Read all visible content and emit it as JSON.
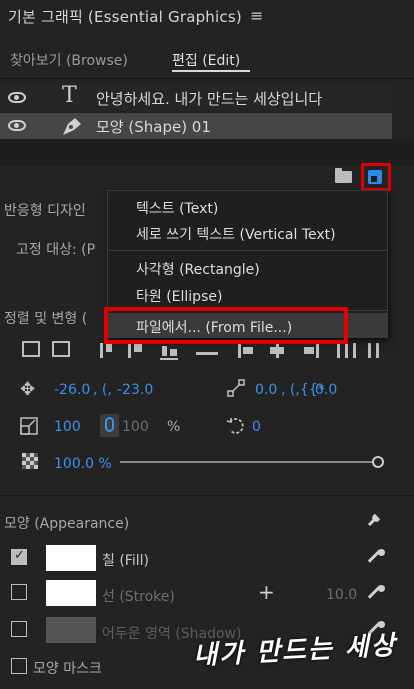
{
  "panel": {
    "title": "기본 그래픽 (Essential Graphics)",
    "menu_icon": "hamburger-icon"
  },
  "tabs": [
    {
      "label": "찾아보기 (Browse)",
      "active": false
    },
    {
      "label": "편집 (Edit)",
      "active": true
    }
  ],
  "layers": [
    {
      "type_icon": "text-T-icon",
      "name": "안녕하세요. 내가 만드는 세상입니다",
      "selected": false
    },
    {
      "type_icon": "pen-icon",
      "name": "모양 (Shape) 01",
      "selected": true
    }
  ],
  "toolbar": {
    "folder_icon": "folder-icon",
    "new_layer_icon": "new-layer-icon"
  },
  "new_layer_menu": {
    "items": [
      {
        "label": "텍스트 (Text)"
      },
      {
        "label": "세로 쓰기 텍스트 (Vertical Text)"
      },
      {
        "label": "사각형 (Rectangle)"
      },
      {
        "label": "타원 (Ellipse)"
      },
      {
        "label": "파일에서... (From File...)",
        "hovered": true
      }
    ]
  },
  "responsive": {
    "label": "반응형 디자인",
    "pin_label": "고정 대상: (P"
  },
  "align_transform": {
    "label": "정렬 및 변형 ("
  },
  "transform": {
    "position_x": "-26.0",
    "position_y_sep": ", (,",
    "position_y": "-23.0",
    "anchor_value": "0.0",
    "anchor_sep": ", (,{{*",
    "anchor_y": "0.0",
    "scale": "100",
    "scale_locked": "100",
    "scale_unit": "%",
    "rotation": "0",
    "opacity": "100.0 %",
    "opacity_level": 1.0
  },
  "appearance": {
    "label": "모양 (Appearance)",
    "wrench_icon": "wrench-icon",
    "fill": {
      "label": "칠 (Fill)",
      "checked": true,
      "color": "#ffffff"
    },
    "stroke": {
      "label": "선 (Stroke)",
      "checked": false,
      "color": "#ffffff",
      "value": "10.0"
    },
    "shadow": {
      "label": "어두운 영역 (Shadow)",
      "checked": false,
      "color": "#555555"
    },
    "mask": {
      "label": "모양 마스크",
      "checked": false
    }
  },
  "watermark": "내가 만드는 세상",
  "colors": {
    "accent_blue": "#3e90e8",
    "highlight_red": "#e00000",
    "panel_bg": "#232323"
  }
}
